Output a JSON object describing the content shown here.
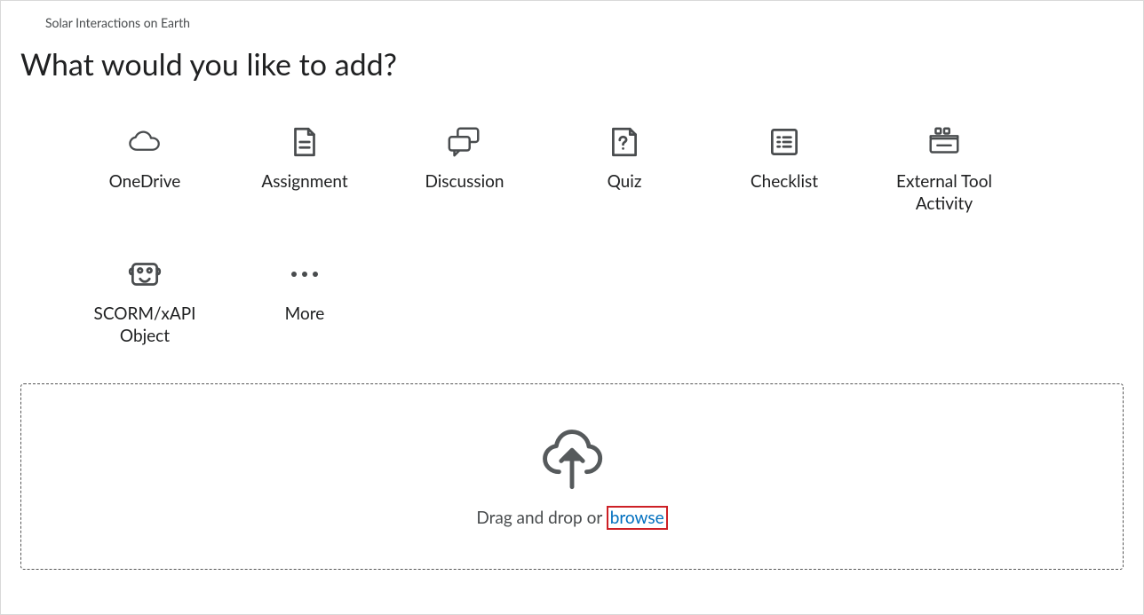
{
  "breadcrumb": "Solar Interactions on Earth",
  "title": "What would you like to add?",
  "tiles": [
    {
      "label": "OneDrive"
    },
    {
      "label": "Assignment"
    },
    {
      "label": "Discussion"
    },
    {
      "label": "Quiz"
    },
    {
      "label": "Checklist"
    },
    {
      "label": "External Tool Activity"
    },
    {
      "label": "SCORM/xAPI Object"
    },
    {
      "label": "More"
    }
  ],
  "dropzone": {
    "prefix_text": "Drag and drop or ",
    "browse_label": "browse"
  }
}
